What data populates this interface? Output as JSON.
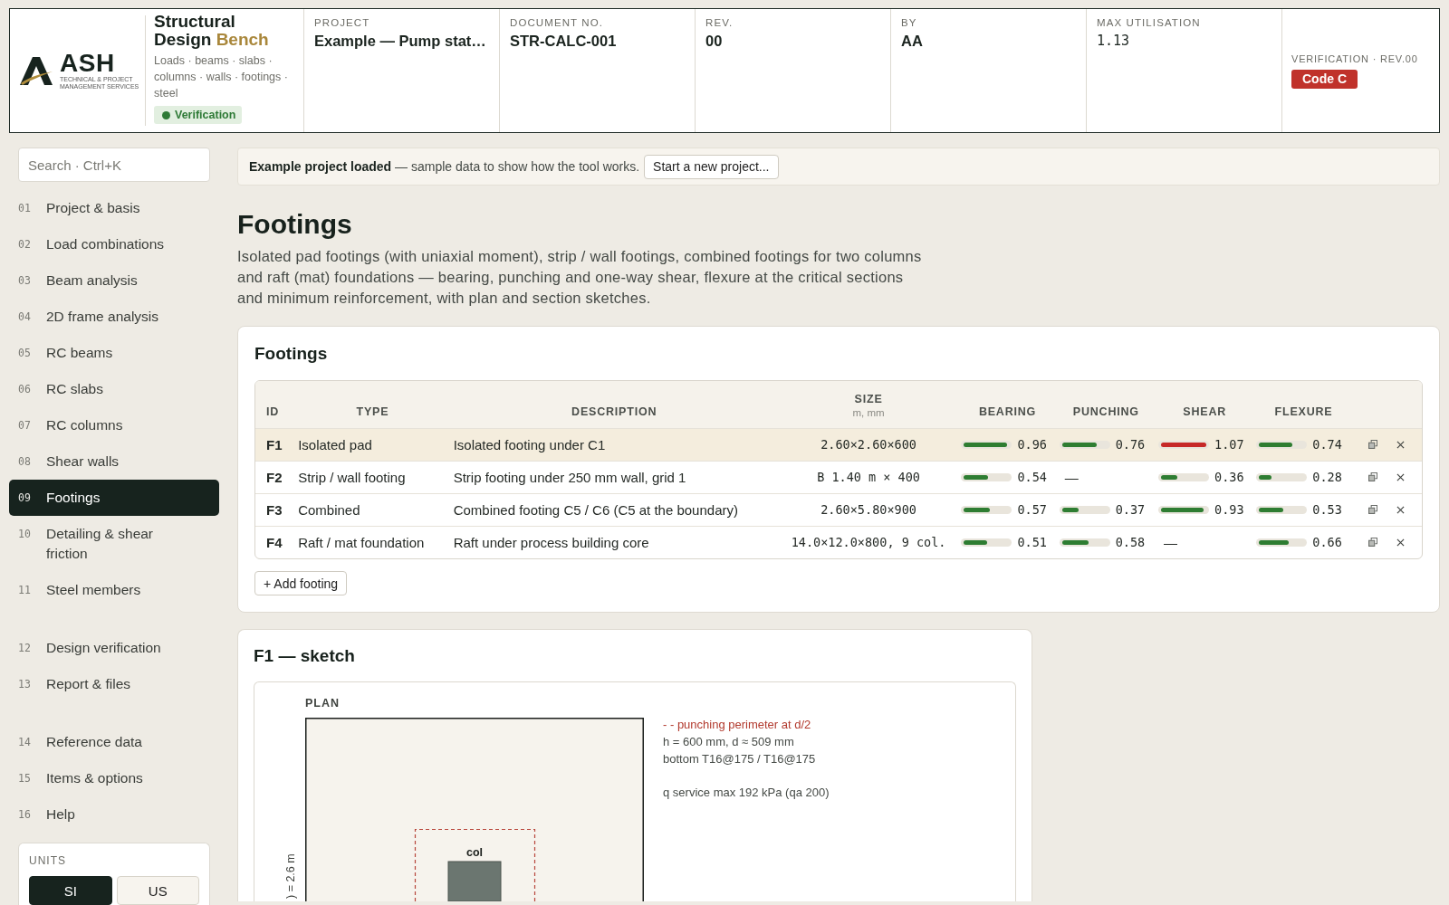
{
  "header": {
    "logo": {
      "wordmark": "ASH",
      "tagline": [
        "TECHNICAL & PROJECT",
        "MANAGEMENT SERVICES"
      ]
    },
    "app": {
      "title": "Structural Design",
      "title_accent": "Bench",
      "subtitle": "Loads · beams · slabs · columns · walls · footings · steel",
      "status": "Verification"
    },
    "fields": [
      {
        "label": "PROJECT",
        "value": "Example — Pump stat…",
        "kind": "text"
      },
      {
        "label": "DOCUMENT NO.",
        "value": "STR-CALC-001",
        "kind": "text"
      },
      {
        "label": "REV.",
        "value": "00",
        "kind": "text"
      },
      {
        "label": "BY",
        "value": "AA",
        "kind": "text"
      },
      {
        "label": "MAX UTILISATION",
        "value": "1.13",
        "kind": "mono"
      }
    ],
    "verification": {
      "label": "VERIFICATION · REV.00",
      "code": "Code C"
    }
  },
  "sidebar": {
    "search": {
      "placeholder": "Search · Ctrl+K"
    },
    "nav_groups": [
      {
        "items": [
          {
            "number": "01",
            "label": "Project & basis",
            "selected": false
          },
          {
            "number": "02",
            "label": "Load combinations",
            "selected": false
          },
          {
            "number": "03",
            "label": "Beam analysis",
            "selected": false
          },
          {
            "number": "04",
            "label": "2D frame analysis",
            "selected": false
          },
          {
            "number": "05",
            "label": "RC beams",
            "selected": false
          },
          {
            "number": "06",
            "label": "RC slabs",
            "selected": false
          },
          {
            "number": "07",
            "label": "RC columns",
            "selected": false
          },
          {
            "number": "08",
            "label": "Shear walls",
            "selected": false
          },
          {
            "number": "09",
            "label": "Footings",
            "selected": true
          },
          {
            "number": "10",
            "label": "Detailing & shear friction",
            "selected": false
          },
          {
            "number": "11",
            "label": "Steel members",
            "selected": false
          }
        ]
      },
      {
        "items": [
          {
            "number": "12",
            "label": "Design verification",
            "selected": false
          },
          {
            "number": "13",
            "label": "Report & files",
            "selected": false
          }
        ]
      },
      {
        "items": [
          {
            "number": "14",
            "label": "Reference data",
            "selected": false
          },
          {
            "number": "15",
            "label": "Items & options",
            "selected": false
          },
          {
            "number": "16",
            "label": "Help",
            "selected": false
          }
        ]
      }
    ],
    "units": {
      "label": "UNITS",
      "options": [
        {
          "label": "SI",
          "selected": true
        },
        {
          "label": "US",
          "selected": false
        }
      ]
    }
  },
  "notice": {
    "text": "**Example project loaded** — sample data to show how the tool works.",
    "button": "Start a new project..."
  },
  "page": {
    "title": "Footings",
    "description": "Isolated pad footings (with uniaxial moment), strip / wall footings, combined footings for two columns and raft (mat) foundations — bearing, punching and one-way shear, flexure at the critical sections and minimum reinforcement, with plan and section sketches."
  },
  "footings_card": {
    "title": "Footings",
    "table": {
      "columns": [
        {
          "label": "ID"
        },
        {
          "label": "TYPE"
        },
        {
          "label": "DESCRIPTION"
        },
        {
          "label": "SIZE",
          "unit": "m, mm"
        },
        {
          "label": "BEARING"
        },
        {
          "label": "PUNCHING"
        },
        {
          "label": "SHEAR"
        },
        {
          "label": "FLEXURE"
        }
      ],
      "rows": [
        {
          "id": "F1",
          "type": "Isolated pad",
          "description": "Isolated footing under C1",
          "size": "2.60×2.60×600",
          "selected": true,
          "checks": [
            {
              "kind": "bar",
              "level": 0.96,
              "reading": "0.96",
              "color": "#2e7d32"
            },
            {
              "kind": "bar",
              "level": 0.76,
              "reading": "0.76",
              "color": "#2e7d32"
            },
            {
              "kind": "bar",
              "level": 1,
              "reading": "1.07",
              "color": "#c62828"
            },
            {
              "kind": "bar",
              "level": 0.74,
              "reading": "0.74",
              "color": "#2e7d32"
            }
          ]
        },
        {
          "id": "F2",
          "type": "Strip / wall footing",
          "description": "Strip footing under 250 mm wall, grid 1",
          "size": "B 1.40 m × 400",
          "selected": false,
          "checks": [
            {
              "kind": "bar",
              "level": 0.54,
              "reading": "0.54",
              "color": "#2e7d32"
            },
            {
              "kind": "none",
              "reading": "—"
            },
            {
              "kind": "bar",
              "level": 0.36,
              "reading": "0.36",
              "color": "#2e7d32"
            },
            {
              "kind": "bar",
              "level": 0.28,
              "reading": "0.28",
              "color": "#2e7d32"
            }
          ]
        },
        {
          "id": "F3",
          "type": "Combined",
          "description": "Combined footing C5 / C6 (C5 at the boundary)",
          "size": "2.60×5.80×900",
          "selected": false,
          "checks": [
            {
              "kind": "bar",
              "level": 0.57,
              "reading": "0.57",
              "color": "#2e7d32"
            },
            {
              "kind": "bar",
              "level": 0.37,
              "reading": "0.37",
              "color": "#2e7d32"
            },
            {
              "kind": "bar",
              "level": 0.93,
              "reading": "0.93",
              "color": "#2e7d32"
            },
            {
              "kind": "bar",
              "level": 0.53,
              "reading": "0.53",
              "color": "#2e7d32"
            }
          ]
        },
        {
          "id": "F4",
          "type": "Raft / mat foundation",
          "description": "Raft under process building core",
          "size": "14.0×12.0×800, 9 col.",
          "selected": false,
          "checks": [
            {
              "kind": "bar",
              "level": 0.51,
              "reading": "0.51",
              "color": "#2e7d32"
            },
            {
              "kind": "bar",
              "level": 0.58,
              "reading": "0.58",
              "color": "#2e7d32"
            },
            {
              "kind": "none",
              "reading": "—"
            },
            {
              "kind": "bar",
              "level": 0.66,
              "reading": "0.66",
              "color": "#2e7d32"
            }
          ]
        }
      ]
    },
    "add_button": "+ Add footing"
  },
  "sketch_card": {
    "title": "F1 — sketch",
    "plan": {
      "label": "PLAN",
      "column_label": "col",
      "dimension": ") = 2.6 m"
    },
    "legend": "- - punching perimeter at d/2",
    "notes": [
      [
        "h = 600 mm, d ≈ 509 mm",
        "bottom T16@175 / T16@175"
      ],
      [
        "q service max 192 kPa (qa 200)"
      ]
    ]
  }
}
